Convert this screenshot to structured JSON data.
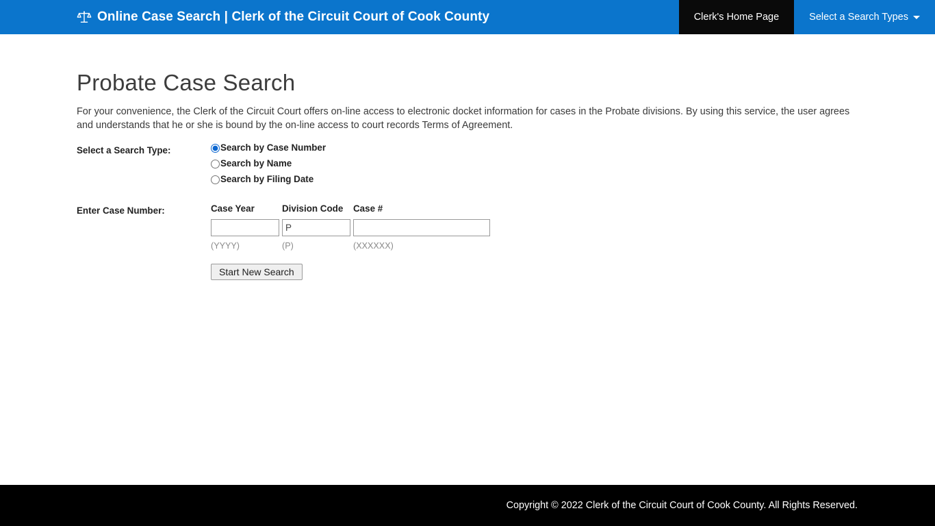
{
  "navbar": {
    "brand_icon": "scales-of-justice-icon",
    "brand_title": "Online Case Search | Clerk of the Circuit Court of Cook County",
    "items": [
      {
        "label": "Clerk's Home Page",
        "active": true
      },
      {
        "label": "Select a Search Types",
        "active": false,
        "caret": "chevron-down-icon"
      }
    ]
  },
  "main": {
    "title": "Probate Case Search",
    "intro": "For your convenience, the Clerk of the Circuit Court offers on-line access to electronic docket information for cases in the Probate divisions. By using this service, the user agrees and understands that he or she is bound by the on-line access to court records Terms of Agreement.",
    "search_type": {
      "label": "Select a Search Type:",
      "options": [
        {
          "label": "Search by Case Number",
          "selected": true
        },
        {
          "label": "Search by Name",
          "selected": false
        },
        {
          "label": "Search by Filing Date",
          "selected": false
        }
      ]
    },
    "case_number": {
      "label": "Enter Case Number:",
      "fields": [
        {
          "header": "Case Year",
          "value": "",
          "hint": "(YYYY)"
        },
        {
          "header": "Division Code",
          "value": "P",
          "hint": "(P)"
        },
        {
          "header": "Case #",
          "value": "",
          "hint": "(XXXXXX)"
        }
      ]
    },
    "submit_label": "Start New Search"
  },
  "footer": {
    "copyright": "Copyright © 2022 Clerk of the Circuit Court of Cook County. All Rights Reserved."
  },
  "colors": {
    "navbar_blue": "#0b75cc",
    "active_tab": "#0a0a0a",
    "footer_black": "#000000",
    "radio_accent": "#0b66d0"
  }
}
